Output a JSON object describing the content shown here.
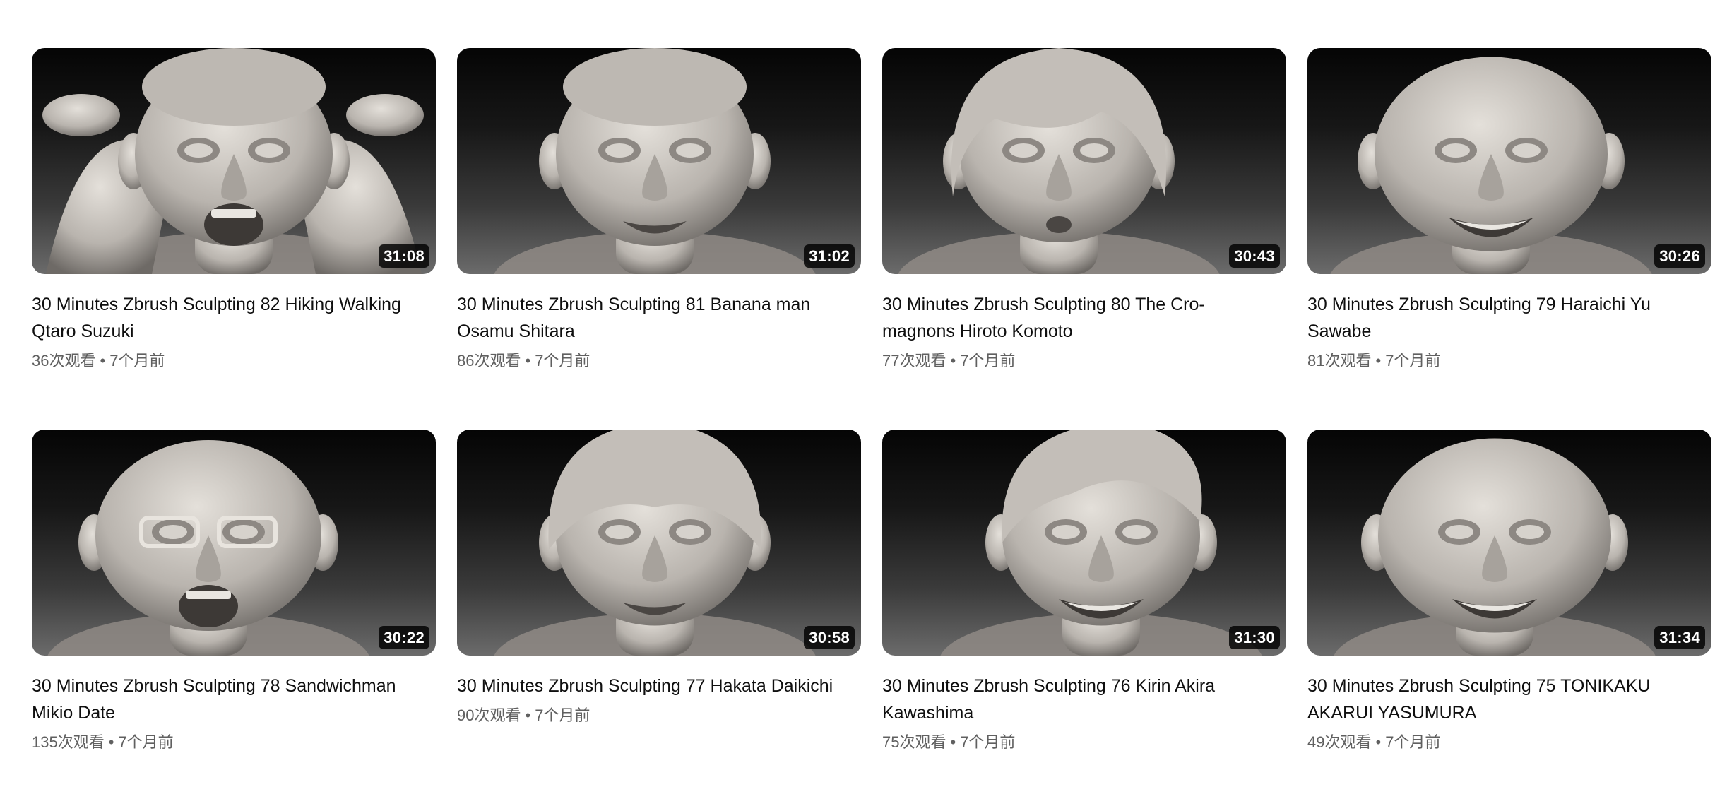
{
  "videos": [
    {
      "title": "30 Minutes Zbrush Sculpting 82 Hiking Walking Qtaro Suzuki",
      "duration": "31:08",
      "views": "36次观看",
      "age": "7个月前",
      "thumb_icon": "sculpted-head-thumbnail"
    },
    {
      "title": "30 Minutes Zbrush Sculpting 81 Banana man Osamu Shitara",
      "duration": "31:02",
      "views": "86次观看",
      "age": "7个月前",
      "thumb_icon": "sculpted-head-thumbnail"
    },
    {
      "title": "30 Minutes Zbrush Sculpting 80 The Cro-magnons Hiroto Komoto",
      "duration": "30:43",
      "views": "77次观看",
      "age": "7个月前",
      "thumb_icon": "sculpted-head-thumbnail"
    },
    {
      "title": "30 Minutes Zbrush Sculpting 79 Haraichi Yu Sawabe",
      "duration": "30:26",
      "views": "81次观看",
      "age": "7个月前",
      "thumb_icon": "sculpted-head-thumbnail"
    },
    {
      "title": "30 Minutes Zbrush Sculpting 78 Sandwichman Mikio Date",
      "duration": "30:22",
      "views": "135次观看",
      "age": "7个月前",
      "thumb_icon": "sculpted-head-thumbnail"
    },
    {
      "title": "30 Minutes Zbrush Sculpting 77 Hakata Daikichi",
      "duration": "30:58",
      "views": "90次观看",
      "age": "7个月前",
      "thumb_icon": "sculpted-head-thumbnail"
    },
    {
      "title": "30 Minutes Zbrush Sculpting 76 Kirin Akira Kawashima",
      "duration": "31:30",
      "views": "75次观看",
      "age": "7个月前",
      "thumb_icon": "sculpted-head-thumbnail"
    },
    {
      "title": "30 Minutes Zbrush Sculpting 75 TONIKAKU AKARUI YASUMURA",
      "duration": "31:34",
      "views": "49次观看",
      "age": "7个月前",
      "thumb_icon": "sculpted-head-thumbnail"
    }
  ],
  "separator": "•",
  "colors": {
    "title_text": "#0f0f0f",
    "meta_text": "#606060",
    "duration_bg": "#000000",
    "duration_text": "#ffffff",
    "sculpt_clay": "#b9b4ae"
  }
}
